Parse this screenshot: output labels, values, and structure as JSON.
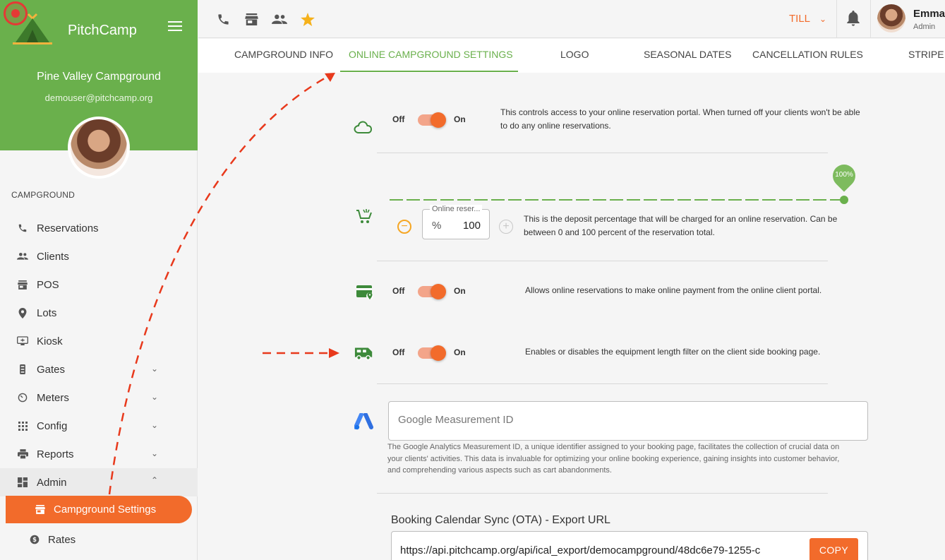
{
  "app": {
    "brand": "PitchCamp",
    "campground_name": "Pine Valley Campground",
    "email": "demouser@pitchcamp.org"
  },
  "sidebar": {
    "section": "CAMPGROUND",
    "items": [
      {
        "label": "Reservations",
        "icon": "phone-icon"
      },
      {
        "label": "Clients",
        "icon": "people-icon"
      },
      {
        "label": "POS",
        "icon": "store-icon"
      },
      {
        "label": "Lots",
        "icon": "location-pin-icon"
      },
      {
        "label": "Kiosk",
        "icon": "kiosk-icon"
      },
      {
        "label": "Gates",
        "icon": "gate-icon"
      },
      {
        "label": "Meters",
        "icon": "meter-icon"
      },
      {
        "label": "Config",
        "icon": "grid-icon"
      },
      {
        "label": "Reports",
        "icon": "printer-icon"
      },
      {
        "label": "Admin",
        "icon": "dashboard-icon"
      }
    ],
    "active_item": "Campground Settings",
    "sub_item": "Rates"
  },
  "topbar": {
    "till": "TILL",
    "user_name": "Emma",
    "user_role": "Admin"
  },
  "tabs": [
    "CAMPGROUND INFO",
    "ONLINE CAMPGROUND SETTINGS",
    "LOGO",
    "SEASONAL DATES",
    "CANCELLATION RULES",
    "STRIPE"
  ],
  "settings": {
    "off_label": "Off",
    "on_label": "On",
    "portal_desc": "This controls access to your online reservation portal. When turned off your clients won't be able to do any online reservations.",
    "deposit": {
      "slider_percent": 100,
      "slider_label": "100%",
      "field_label": "Online reser...",
      "prefix": "%",
      "value": "100",
      "desc": "This is the deposit percentage that will be charged for an online reservation. Can be between 0 and 100 percent of the reservation total."
    },
    "payment_desc": "Allows online reservations to make online payment from the online client portal.",
    "equipment_desc": "Enables or disables the equipment length filter on the client side booking page.",
    "ga": {
      "placeholder": "Google Measurement ID",
      "help": "The Google Analytics Measurement ID, a unique identifier assigned to your booking page, facilitates the collection of crucial data on your clients' activities. This data is invaluable for optimizing your online booking experience, gaining insights into customer behavior, and comprehending various aspects such as cart abandonments."
    },
    "ota": {
      "title": "Booking Calendar Sync (OTA) - Export URL",
      "url": "https://api.pitchcamp.org/api/ical_export/democampground/48dc6e79-1255-c",
      "copy": "COPY"
    }
  },
  "colors": {
    "brand_green": "#6ab04c",
    "accent_orange": "#f26b2b",
    "annotation_red": "#e53935"
  }
}
